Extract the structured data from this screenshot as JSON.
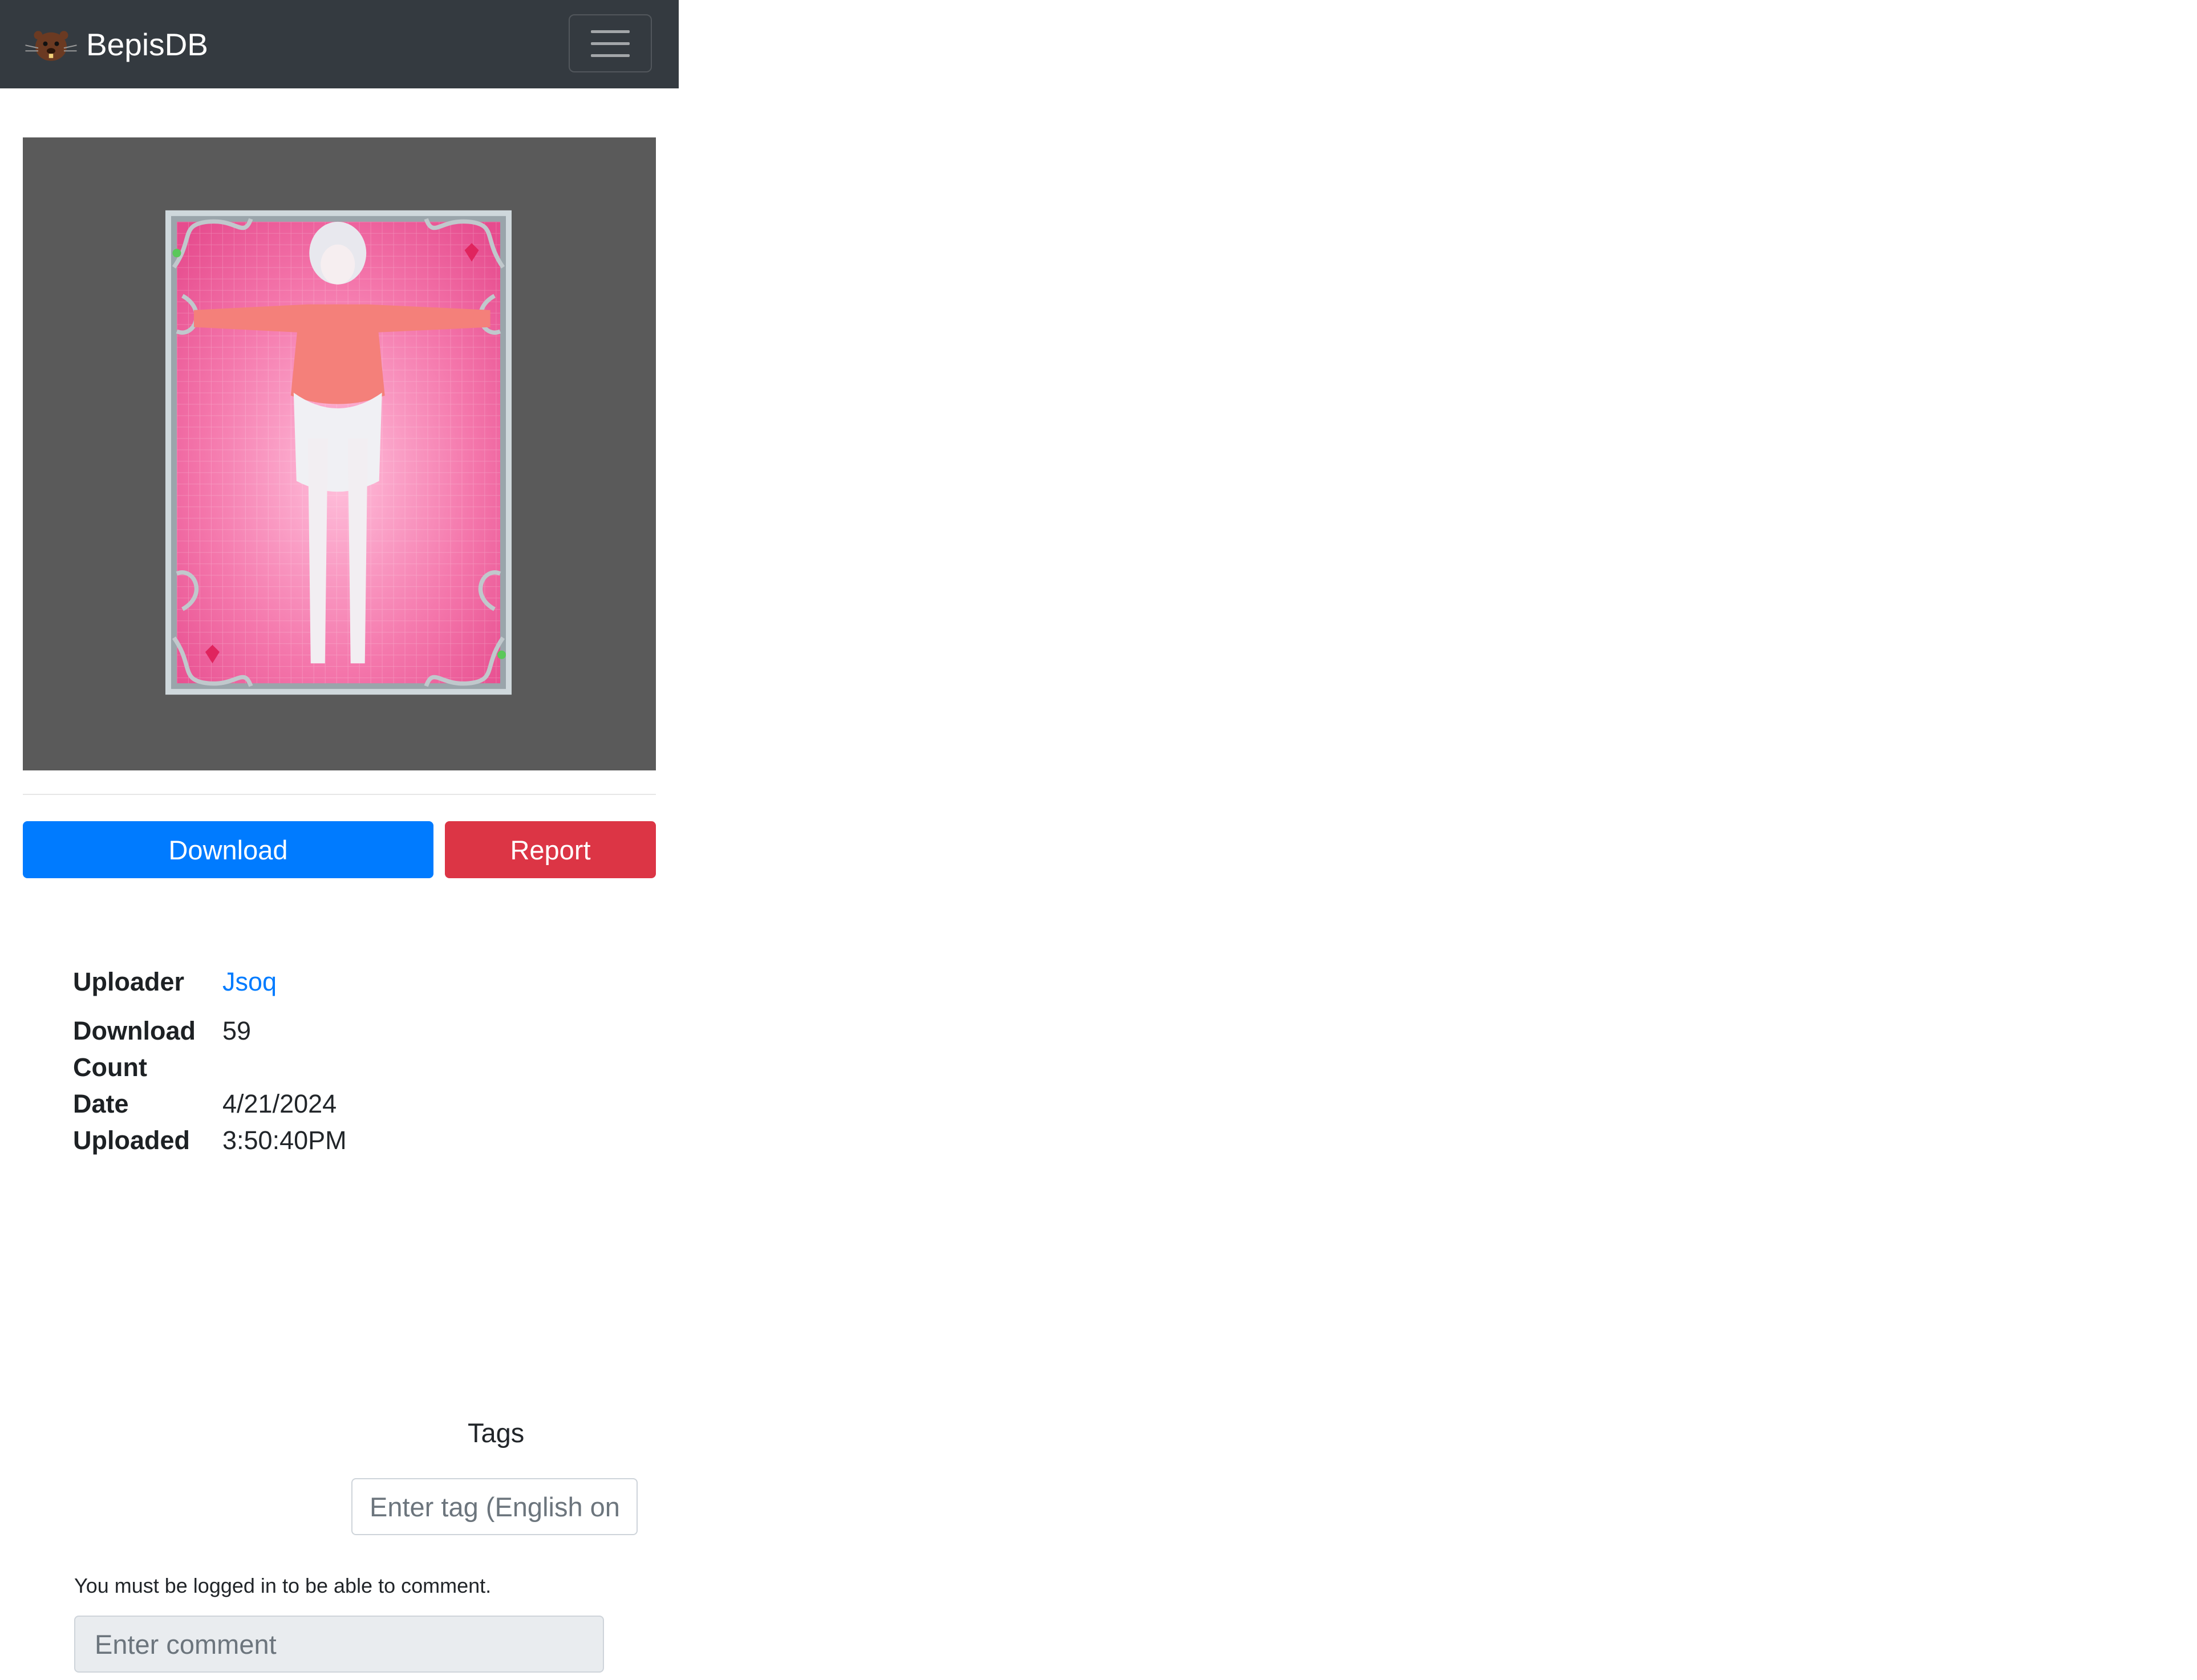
{
  "app": {
    "brand": "BepisDB",
    "logo_icon": "beaver-logo-icon",
    "menu_icon": "hamburger-menu-icon"
  },
  "colors": {
    "navbar": "#343a40",
    "primary": "#007bff",
    "danger": "#dc3545",
    "preview_bg": "#5a5a5a",
    "card_pink": "#f06292"
  },
  "actions": {
    "download_label": "Download",
    "report_label": "Report"
  },
  "meta": {
    "uploader_label": "Uploader",
    "uploader_value": "Jsoq",
    "download_count_label_1": "Download",
    "download_count_label_2": "Count",
    "download_count_value": "59",
    "date_label_1": "Date",
    "date_label_2": "Uploaded",
    "date_value_1": "4/21/2024",
    "date_value_2": "3:50:40PM"
  },
  "tags": {
    "title": "Tags",
    "input_placeholder": "Enter tag (English only)"
  },
  "comments": {
    "login_note": "You must be logged in to be able to comment.",
    "input_placeholder": "Enter comment"
  }
}
